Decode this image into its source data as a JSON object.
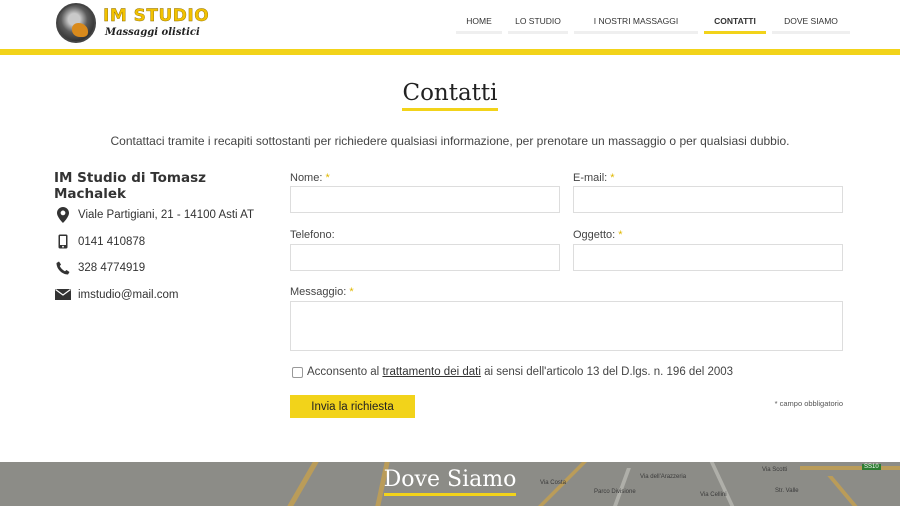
{
  "brand": {
    "title": "IM STUDIO",
    "subtitle": "Massaggi olistici"
  },
  "nav": [
    {
      "label": "HOME",
      "active": false
    },
    {
      "label": "LO STUDIO",
      "active": false
    },
    {
      "label": "I NOSTRI MASSAGGI",
      "active": false
    },
    {
      "label": "CONTATTI",
      "active": true
    },
    {
      "label": "DOVE SIAMO",
      "active": false
    }
  ],
  "page_title": "Contatti",
  "intro": "Contattaci tramite i recapiti sottostanti per richiedere qualsiasi informazione, per prenotare un massaggio o per qualsiasi dubbio.",
  "contact": {
    "company": "IM Studio di Tomasz Machalek",
    "address": "Viale Partigiani, 21 - 14100 Asti AT",
    "phone": "0141 410878",
    "mobile": "328 4774919",
    "email": "imstudio@mail.com"
  },
  "form": {
    "name_label": "Nome:",
    "email_label": "E-mail:",
    "phone_label": "Telefono:",
    "subject_label": "Oggetto:",
    "message_label": "Messaggio:",
    "required_mark": "*",
    "name_value": "",
    "email_value": "",
    "phone_value": "",
    "subject_value": "",
    "message_value": "",
    "consent_before": "Acconsento al ",
    "consent_link": "trattamento dei dati",
    "consent_after": " ai sensi dell'articolo 13 del D.lgs. n. 196 del 2003",
    "submit_label": "Invia la richiesta",
    "required_note": "* campo obbligatorio"
  },
  "map": {
    "title": "Dove Siamo",
    "labels": [
      "Via Scotti",
      "Parco Divisione",
      "Via dell'Arazzeria",
      "Via Cellini",
      "Via Costa",
      "Str. Valle",
      "SS10"
    ]
  },
  "colors": {
    "accent": "#f2d31a",
    "text": "#333333"
  },
  "icons": [
    "map-pin-icon",
    "phone-icon",
    "mobile-icon",
    "email-icon"
  ]
}
